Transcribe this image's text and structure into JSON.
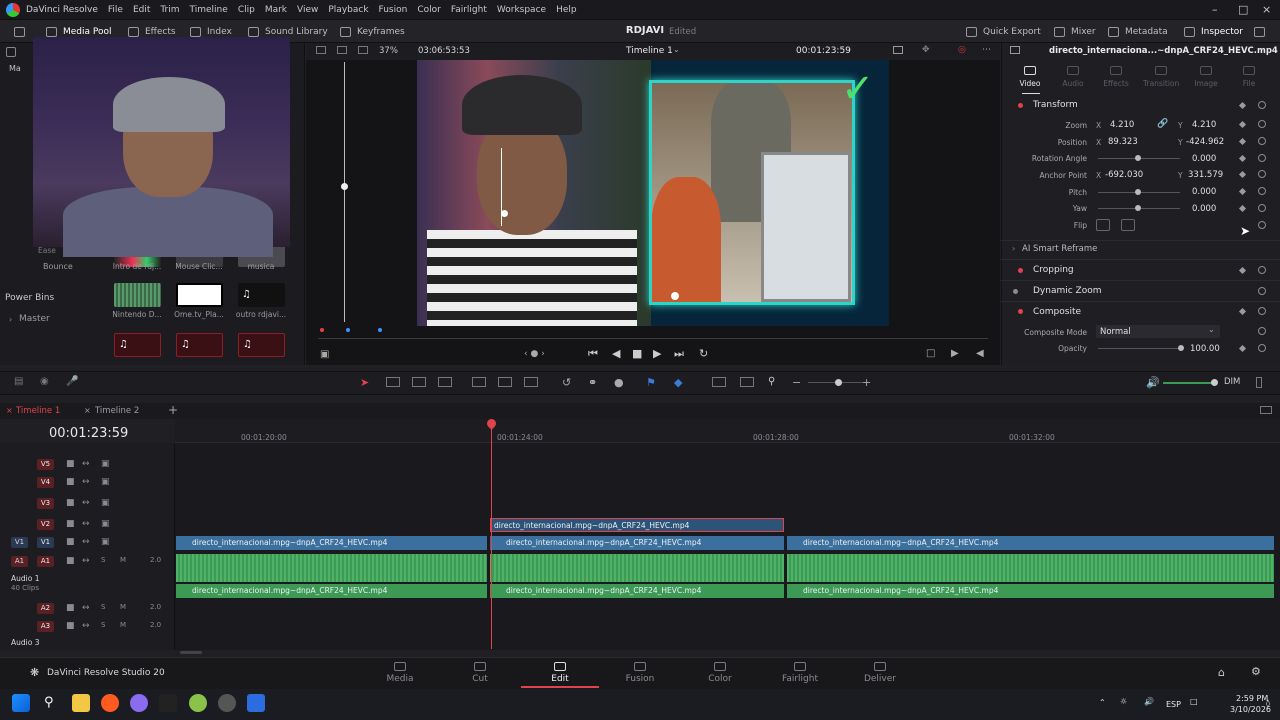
{
  "app": {
    "name": "DaVinci Resolve",
    "menu": [
      "File",
      "Edit",
      "Trim",
      "Timeline",
      "Clip",
      "Mark",
      "View",
      "Playback",
      "Fusion",
      "Color",
      "Fairlight",
      "Workspace",
      "Help"
    ],
    "project_title": "RDJAVI",
    "project_status": "Edited",
    "brand": "DaVinci Resolve Studio 20"
  },
  "toolbar": {
    "media_pool": "Media Pool",
    "effects": "Effects",
    "index": "Index",
    "sound_library": "Sound Library",
    "keyframes": "Keyframes",
    "quick_export": "Quick Export",
    "mixer": "Mixer",
    "metadata": "Metadata",
    "inspector": "Inspector"
  },
  "viewer": {
    "zoom": "37%",
    "duration": "03:06:53:53",
    "timeline_name": "Timeline 1",
    "timecode": "00:01:23:59",
    "clip_name": "directo_internaciona...~dnpA_CRF24_HEVC.mp4"
  },
  "media_pool": {
    "items": [
      {
        "label": "Intro de rdj..."
      },
      {
        "label": "Mouse Clic..."
      },
      {
        "label": "musica"
      },
      {
        "label": "Nintendo D..."
      },
      {
        "label": "Ome.tv_Pla..."
      },
      {
        "label": "outro rdjavi..."
      }
    ],
    "side_labels": [
      "Ease",
      "Bounce"
    ],
    "power_bins": "Power Bins",
    "master": "Master",
    "master_short": "Ma"
  },
  "inspector": {
    "tabs": [
      {
        "label": "Video",
        "active": true
      },
      {
        "label": "Audio",
        "active": false
      },
      {
        "label": "Effects",
        "active": false
      },
      {
        "label": "Transition",
        "active": false
      },
      {
        "label": "Image",
        "active": false
      },
      {
        "label": "File",
        "active": false
      }
    ],
    "transform": {
      "title": "Transform",
      "zoom": {
        "label": "Zoom",
        "x": "4.210",
        "y": "4.210"
      },
      "position": {
        "label": "Position",
        "x": "89.323",
        "y": "-424.962"
      },
      "rotation": {
        "label": "Rotation Angle",
        "value": "0.000"
      },
      "anchor": {
        "label": "Anchor Point",
        "x": "-692.030",
        "y": "331.579"
      },
      "pitch": {
        "label": "Pitch",
        "value": "0.000"
      },
      "yaw": {
        "label": "Yaw",
        "value": "0.000"
      },
      "flip": {
        "label": "Flip"
      }
    },
    "smart_reframe": "AI Smart Reframe",
    "cropping": "Cropping",
    "dynamic_zoom": "Dynamic Zoom",
    "composite": {
      "title": "Composite",
      "mode_label": "Composite Mode",
      "mode_value": "Normal",
      "opacity_label": "Opacity",
      "opacity_value": "100.00"
    }
  },
  "timeline": {
    "tabs": [
      {
        "label": "Timeline 1",
        "active": true
      },
      {
        "label": "Timeline 2",
        "active": false
      }
    ],
    "timecode": "00:01:23:59",
    "ruler": [
      "00:01:20:00",
      "00:01:24:00",
      "00:01:28:00",
      "00:01:32:00"
    ],
    "tracks": {
      "v5": "V5",
      "v4": "V4",
      "v3": "V3",
      "v2": "V2",
      "v1": "V1",
      "a1": "A1",
      "a2": "A2",
      "a3": "A3",
      "audio1": "Audio 1",
      "audio1_clips": "40 Clips",
      "audio3": "Audio 3",
      "gain": "2.0",
      "solo": "S",
      "mute": "M"
    },
    "clip_name": "directo_internacional.mpg~dnpA_CRF24_HEVC.mp4",
    "dim": "DIM"
  },
  "pages": [
    {
      "label": "Media"
    },
    {
      "label": "Cut"
    },
    {
      "label": "Edit",
      "active": true
    },
    {
      "label": "Fusion"
    },
    {
      "label": "Color"
    },
    {
      "label": "Fairlight"
    },
    {
      "label": "Deliver"
    }
  ],
  "taskbar": {
    "lang": "ESP",
    "time": "2:59 PM",
    "date": "3/10/2026"
  }
}
